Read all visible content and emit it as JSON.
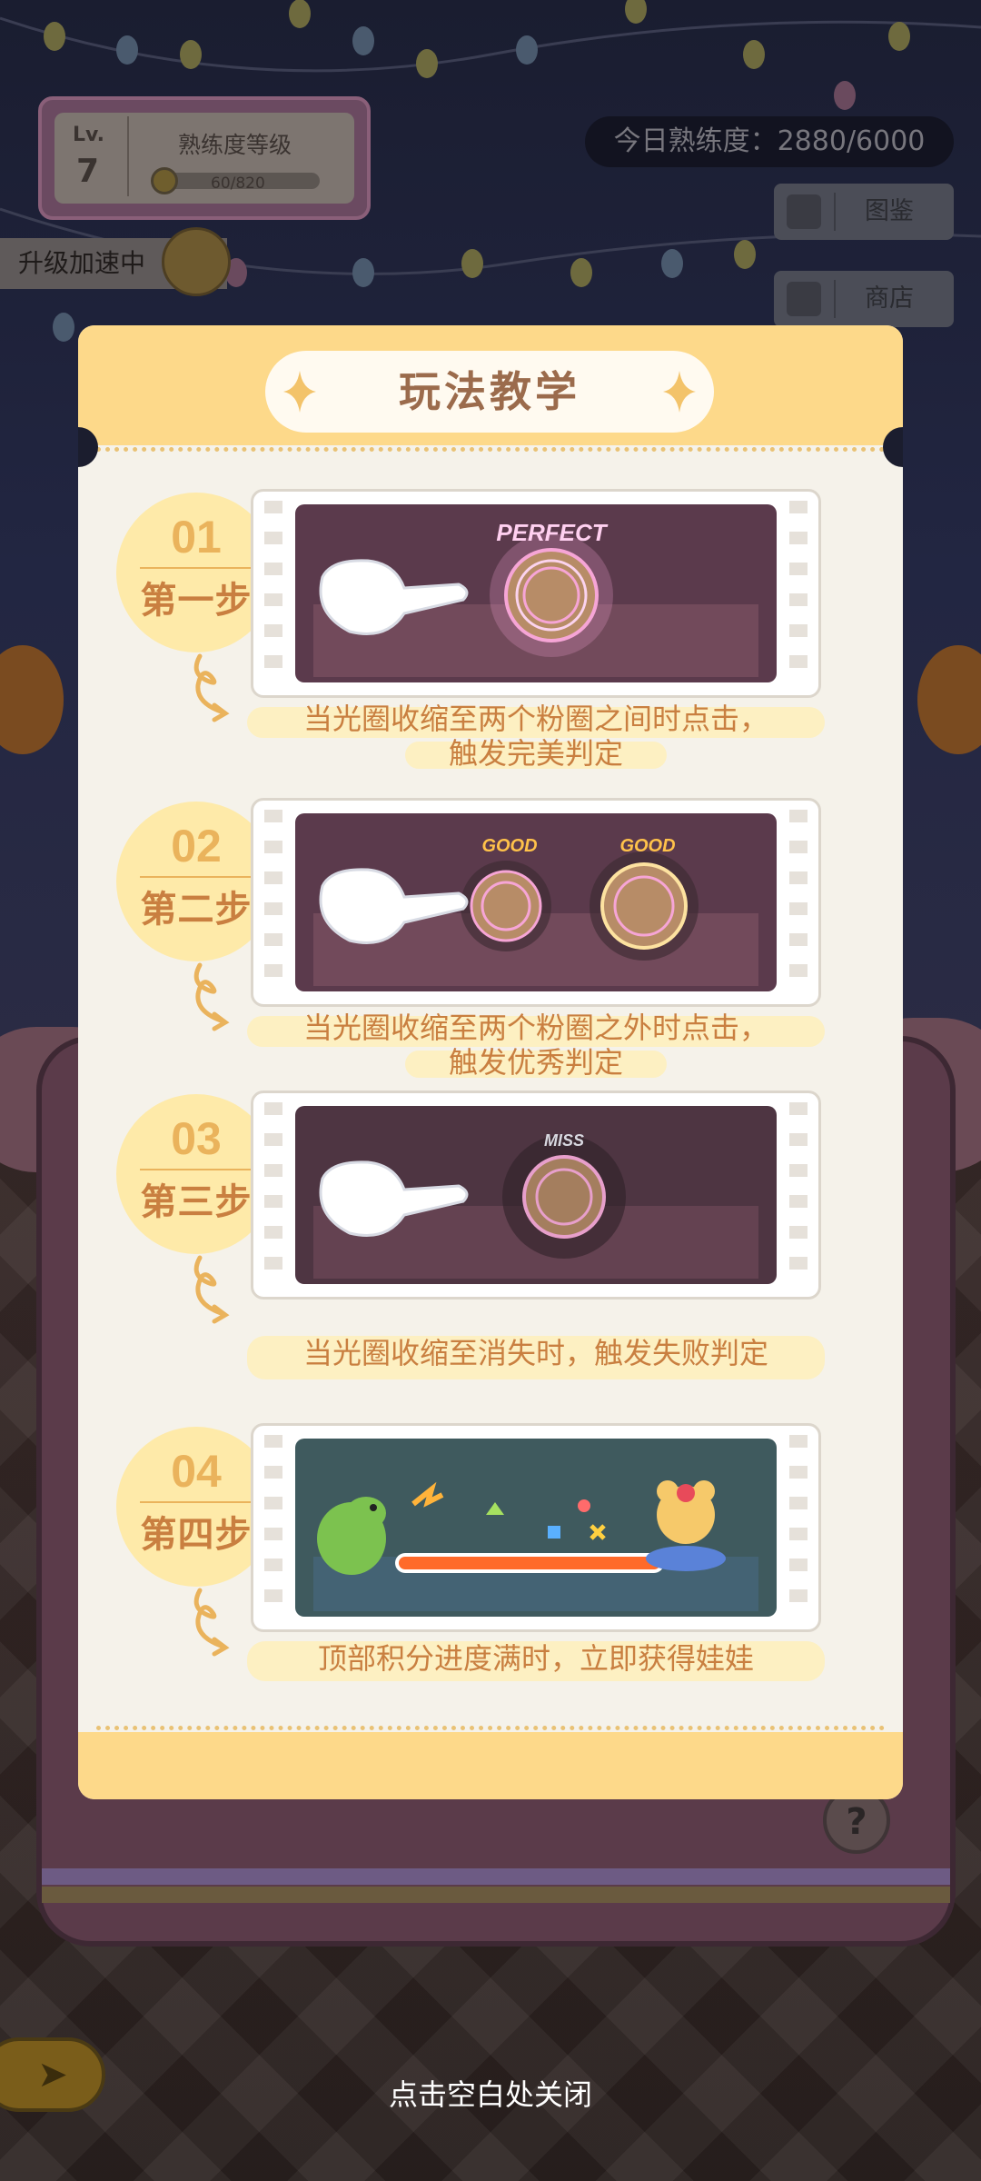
{
  "hud": {
    "level_label": "Lv.",
    "level_value": "7",
    "proficiency_title": "熟练度等级",
    "proficiency_text": "60/820",
    "proficiency_progress": 0.073,
    "boost_label": "升级加速中",
    "daily_text": "今日熟练度：2880/6000",
    "side_buttons": [
      {
        "label": "图鉴",
        "icon": "book-icon"
      },
      {
        "label": "商店",
        "icon": "shop-icon"
      }
    ],
    "help_symbol": "?"
  },
  "modal": {
    "title": "玩法教学",
    "steps": [
      {
        "number": "01",
        "label": "第一步",
        "judge_texts": [
          "PERFECT"
        ],
        "caption_lines": [
          "当光圈收缩至两个粉圈之间时点击，",
          "触发完美判定"
        ]
      },
      {
        "number": "02",
        "label": "第二步",
        "judge_texts": [
          "GOOD",
          "GOOD"
        ],
        "caption_lines": [
          "当光圈收缩至两个粉圈之外时点击，",
          "触发优秀判定"
        ]
      },
      {
        "number": "03",
        "label": "第三步",
        "judge_texts": [
          "MISS"
        ],
        "caption_lines": [
          "当光圈收缩至消失时，触发失败判定"
        ]
      },
      {
        "number": "04",
        "label": "第四步",
        "judge_texts": [],
        "caption_lines": [
          "顶部积分进度满时，立即获得娃娃"
        ]
      }
    ]
  },
  "close_hint": "点击空白处关闭",
  "colors": {
    "panel_bg": "#f5f2ea",
    "header_yellow": "#fdd98a",
    "title_brown": "#9b6b4c",
    "caption_orange": "#c97f40",
    "badge_fill": "#feeaa9",
    "ring_pink": "#f6a5d6",
    "progress_orange": "#ff6a2a"
  }
}
